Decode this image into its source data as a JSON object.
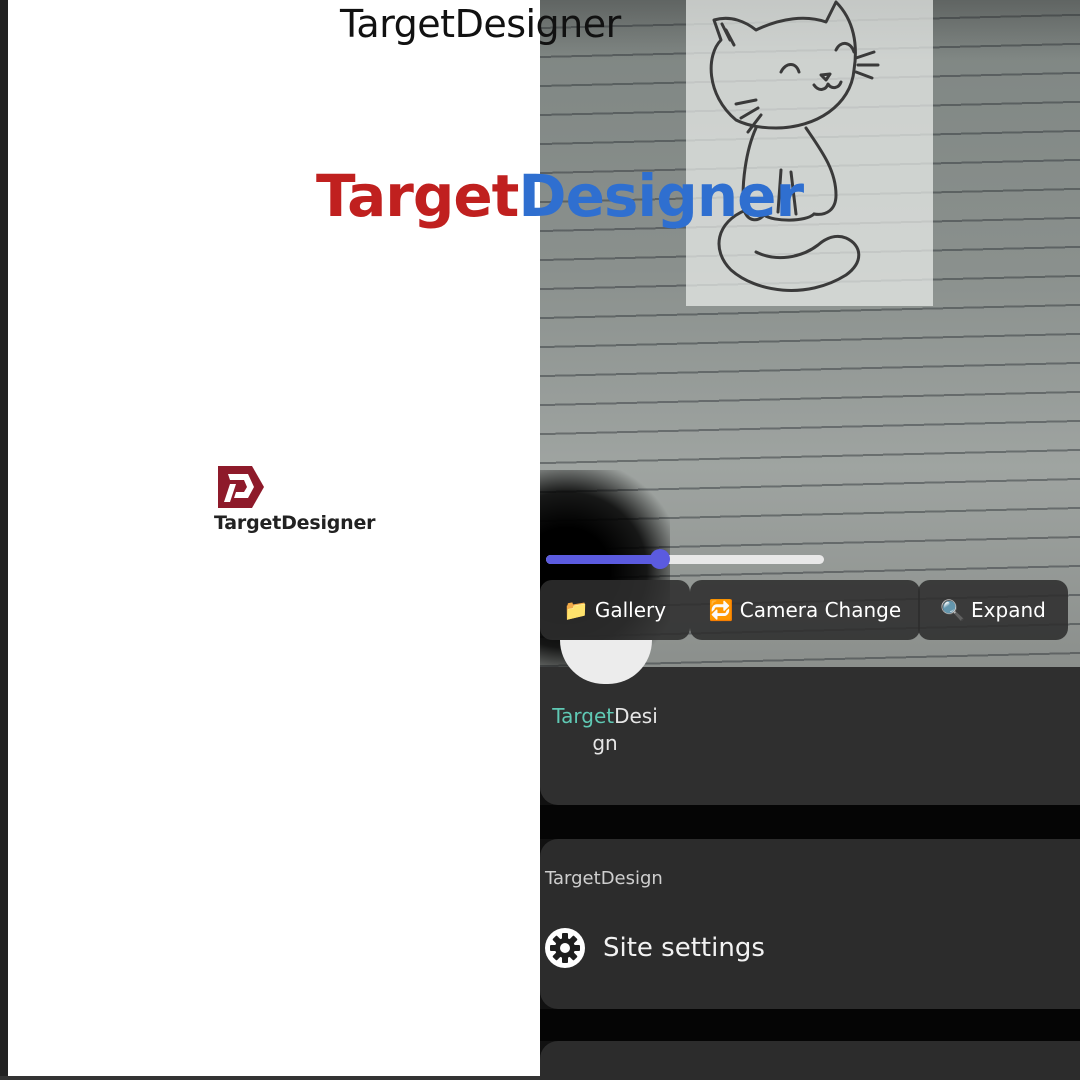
{
  "app_title": "TargetDesigner",
  "hero_title": {
    "part1": "Target",
    "part2": "Designer"
  },
  "splash": {
    "logo_text": "TargetDesigner"
  },
  "camera_controls": {
    "zoom_slider_value": 0.41,
    "buttons": [
      {
        "icon": "folder-icon",
        "glyph": "📁",
        "label": "Gallery"
      },
      {
        "icon": "camera-switch-icon",
        "glyph": "🔁",
        "label": "Camera Change"
      },
      {
        "icon": "magnifier-icon",
        "glyph": "🔍",
        "label": "Expand"
      }
    ]
  },
  "app_shortcut": {
    "label_accent": "Target",
    "label_rest": "Design"
  },
  "site_card": {
    "origin": "TargetDesign",
    "settings_label": "Site settings"
  },
  "colors": {
    "title_red": "#c0201f",
    "title_blue": "#2f6fd0",
    "slider": "#5b5bdf",
    "accent_teal": "#5fc9b4"
  }
}
